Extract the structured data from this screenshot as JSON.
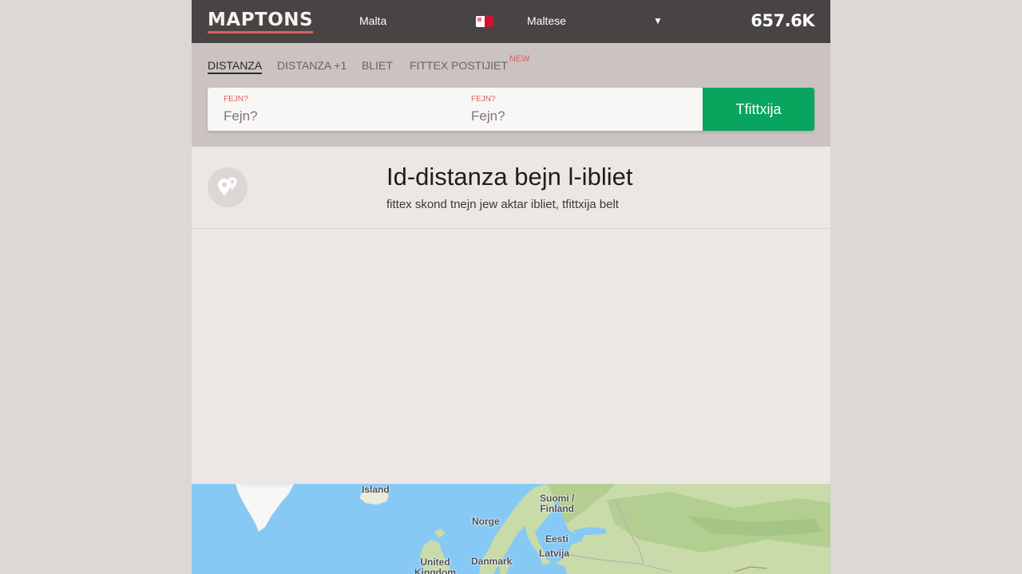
{
  "header": {
    "logo": "MAPTONS",
    "country": "Malta",
    "language": "Maltese",
    "visits": "657.6K"
  },
  "tabs": [
    {
      "label": "DISTANZA",
      "active": true
    },
    {
      "label": "DISTANZA +1",
      "active": false
    },
    {
      "label": "BLIET",
      "active": false
    },
    {
      "label": "FITTEX POSTIJIET",
      "badge": "NEW",
      "active": false
    }
  ],
  "search": {
    "from_label": "FEJN?",
    "from_placeholder": "Fejn?",
    "to_label": "FEJN?",
    "to_placeholder": "Fejn?",
    "button": "Tfittxija"
  },
  "heading": {
    "title": "Id-distanza bejn l-ibliet",
    "subtitle": "fittex skond tnejn jew aktar ibliet, tfittxija belt"
  },
  "map": {
    "labels": {
      "island": "Island",
      "finland": "Suomi /\nFinland",
      "norway": "Norge",
      "estonia": "Eesti",
      "latvia": "Latvija",
      "uk": "United\nKingdom",
      "denmark": "Danmark"
    }
  },
  "colors": {
    "header_bg": "#474443",
    "accent": "#d9605d",
    "button": "#07a55d",
    "sea": "#86c9f5",
    "land": "#c8dba8"
  }
}
